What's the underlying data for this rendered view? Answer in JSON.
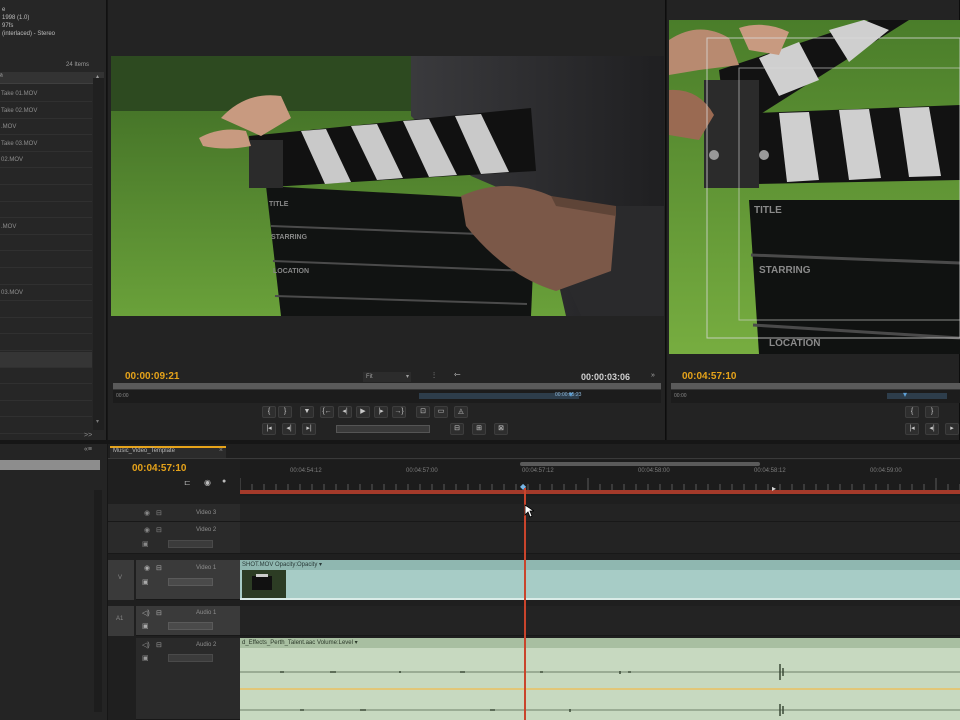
{
  "project": {
    "meta_lines": [
      "e",
      "1998 (1.0)",
      "97fs",
      "(interlaced) - Stereo"
    ],
    "item_count": "24 Items",
    "items": [
      "Take 01.MOV",
      "Take 02.MOV",
      ".MOV",
      "Take 03.MOV",
      "02.MOV",
      "",
      "",
      "",
      ".MOV",
      "",
      "",
      "",
      "03.MOV",
      "",
      "",
      "",
      "",
      "",
      "",
      "",
      ""
    ]
  },
  "source_monitor": {
    "timecode_left": "00:00:09:21",
    "fit_label": "Fit",
    "timecode_right": "00:00:03:06",
    "ruler_left": "00:00",
    "ruler_mid": "00:00:05:23",
    "clapper_labels": [
      "TITLE",
      "STARRING",
      "LOCATION"
    ]
  },
  "program_monitor": {
    "timecode_left": "00:04:57:10",
    "ruler_left": "00:00",
    "clapper_labels": [
      "TITLE",
      "STARRING",
      "LOCATION"
    ]
  },
  "timeline": {
    "tab_label": "Music_Video_Template",
    "timecode": "00:04:57:10",
    "ruler_ticks": [
      "00:04:54:12",
      "00:04:57:00",
      "00:04:57:12",
      "00:04:58:00",
      "00:04:58:12",
      "00:04:59:00"
    ],
    "tracks": [
      {
        "name": "Video 3",
        "kind": "video"
      },
      {
        "name": "Video 2",
        "kind": "video"
      },
      {
        "name": "Video 1",
        "kind": "video"
      },
      {
        "name": "Audio 1",
        "kind": "audio"
      },
      {
        "name": "Audio 2",
        "kind": "audio"
      }
    ],
    "v1_clip_label": "SHOT.MOV  Opacity:Opacity ▾",
    "a2_clip_label": "d_Effects_Perth_Talent.aac  Volume:Level ▾",
    "side_labels": [
      "V",
      "A1"
    ]
  },
  "colors": {
    "accent_timecode": "#e6a31a",
    "playhead": "#c9442c",
    "video_clip": "#a7ccc6",
    "audio_clip": "#c7d9c0"
  }
}
